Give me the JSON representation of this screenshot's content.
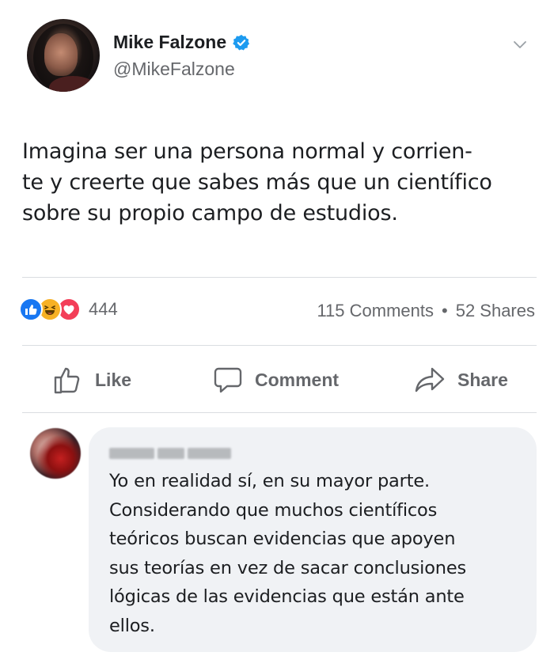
{
  "post": {
    "author_name": "Mike Falzone",
    "author_handle": "@MikeFalzone",
    "text_lines": [
      "Imagina ser una persona normal y corrien-",
      "te y creerte que sabes más que un científico",
      "sobre su propio campo de estudios."
    ]
  },
  "reactions": {
    "icons": [
      "like-icon",
      "haha-icon",
      "love-icon"
    ],
    "count": "444"
  },
  "stats": {
    "comments": "115 Comments",
    "separator": "•",
    "shares": "52 Shares"
  },
  "actions": {
    "like_label": "Like",
    "comment_label": "Comment",
    "share_label": "Share"
  },
  "comment": {
    "text_lines": [
      "Yo en realidad sí, en su mayor parte.",
      "Considerando que muchos científicos",
      "teóricos buscan evidencias que apoyen",
      "sus teorías en vez de sacar conclusiones",
      "lógicas de las evidencias que están ante",
      "ellos."
    ]
  },
  "colors": {
    "accent": "#1877f2",
    "secondary_text": "#65676b",
    "bubble": "#f0f2f5"
  }
}
